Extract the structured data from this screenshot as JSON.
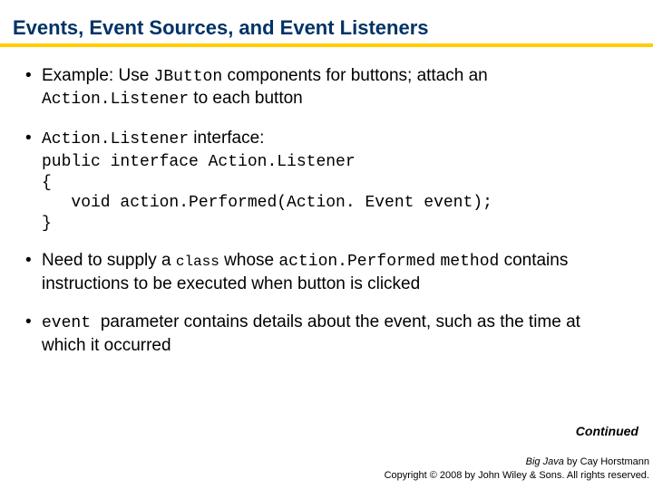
{
  "title": "Events, Event Sources, and Event Listeners",
  "bullets": {
    "b1": {
      "t1": "Example: Use ",
      "code1": "JButton",
      "t2": " components for buttons; attach an ",
      "code2": "Action.Listener",
      "t3": " to each button"
    },
    "b2": {
      "code1": "Action.Listener",
      "t1": " interface:",
      "codeblock": "public interface Action.Listener\n{\n   void action.Performed(Action. Event event);\n}"
    },
    "b3": {
      "t1": "Need to supply a ",
      "codeA": "class",
      "t2": " whose ",
      "codeB": "action.Performed",
      "t3": " ",
      "codeC": "method",
      "t4": " contains instructions to be executed when button is clicked"
    },
    "b4": {
      "code1": "event ",
      "t1": " parameter contains details about the event, such as the time at which it occurred"
    }
  },
  "continued": "Continued",
  "footer": {
    "book": "Big Java",
    "by": " by Cay Horstmann",
    "copyright": "Copyright © 2008 by John Wiley & Sons. All rights reserved."
  }
}
